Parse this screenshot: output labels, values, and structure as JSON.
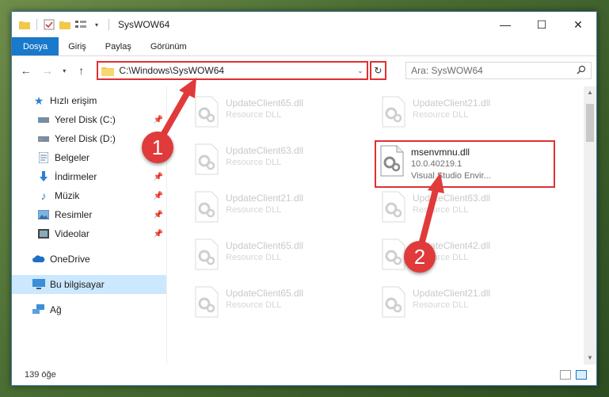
{
  "window": {
    "title": "SysWOW64",
    "controls": {
      "minimize": "—",
      "maximize": "☐",
      "close": "✕"
    }
  },
  "ribbon": {
    "tabs": [
      "Dosya",
      "Giriş",
      "Paylaş",
      "Görünüm"
    ]
  },
  "address": {
    "path": "C:\\Windows\\SysWOW64"
  },
  "search": {
    "placeholder": "Ara: SysWOW64"
  },
  "nav": {
    "quick_access": "Hızlı erişim",
    "items": [
      {
        "label": "Yerel Disk (C:)",
        "icon": "drive-icon",
        "pinned": true
      },
      {
        "label": "Yerel Disk (D:)",
        "icon": "drive-icon",
        "pinned": false
      },
      {
        "label": "Belgeler",
        "icon": "documents-icon",
        "pinned": true
      },
      {
        "label": "İndirmeler",
        "icon": "downloads-icon",
        "pinned": true
      },
      {
        "label": "Müzik",
        "icon": "music-icon",
        "pinned": true
      },
      {
        "label": "Resimler",
        "icon": "pictures-icon",
        "pinned": true
      },
      {
        "label": "Videolar",
        "icon": "videos-icon",
        "pinned": true
      }
    ],
    "onedrive": "OneDrive",
    "this_pc": "Bu bilgisayar",
    "network": "Ağ"
  },
  "files": {
    "left_column": [
      {
        "name": "UpdateClient65.dll",
        "type": "Resource DLL"
      },
      {
        "name": "UpdateClient63.dll",
        "type": "Resource DLL"
      },
      {
        "name": "UpdateClient21.dll",
        "type": "Resource DLL"
      },
      {
        "name": "UpdateClient65.dll",
        "type": "Resource DLL"
      },
      {
        "name": "UpdateClient65.dll",
        "type": "Resource DLL"
      }
    ],
    "right_column": [
      {
        "name": "UpdateClient21.dll",
        "type": "Resource DLL"
      },
      {
        "name": "msenvmnu.dll",
        "version": "10.0.40219.1",
        "type": "Visual Studio Envir...",
        "highlight": true
      },
      {
        "name": "UpdateClient63.dll",
        "type": "Resource DLL"
      },
      {
        "name": "UpdateClient42.dll",
        "type": "Resource DLL"
      },
      {
        "name": "UpdateClient21.dll",
        "type": "Resource DLL"
      }
    ]
  },
  "status": {
    "item_count": "139 öğe"
  },
  "annotations": {
    "step1": "1",
    "step2": "2",
    "color": "#e03a3a"
  }
}
